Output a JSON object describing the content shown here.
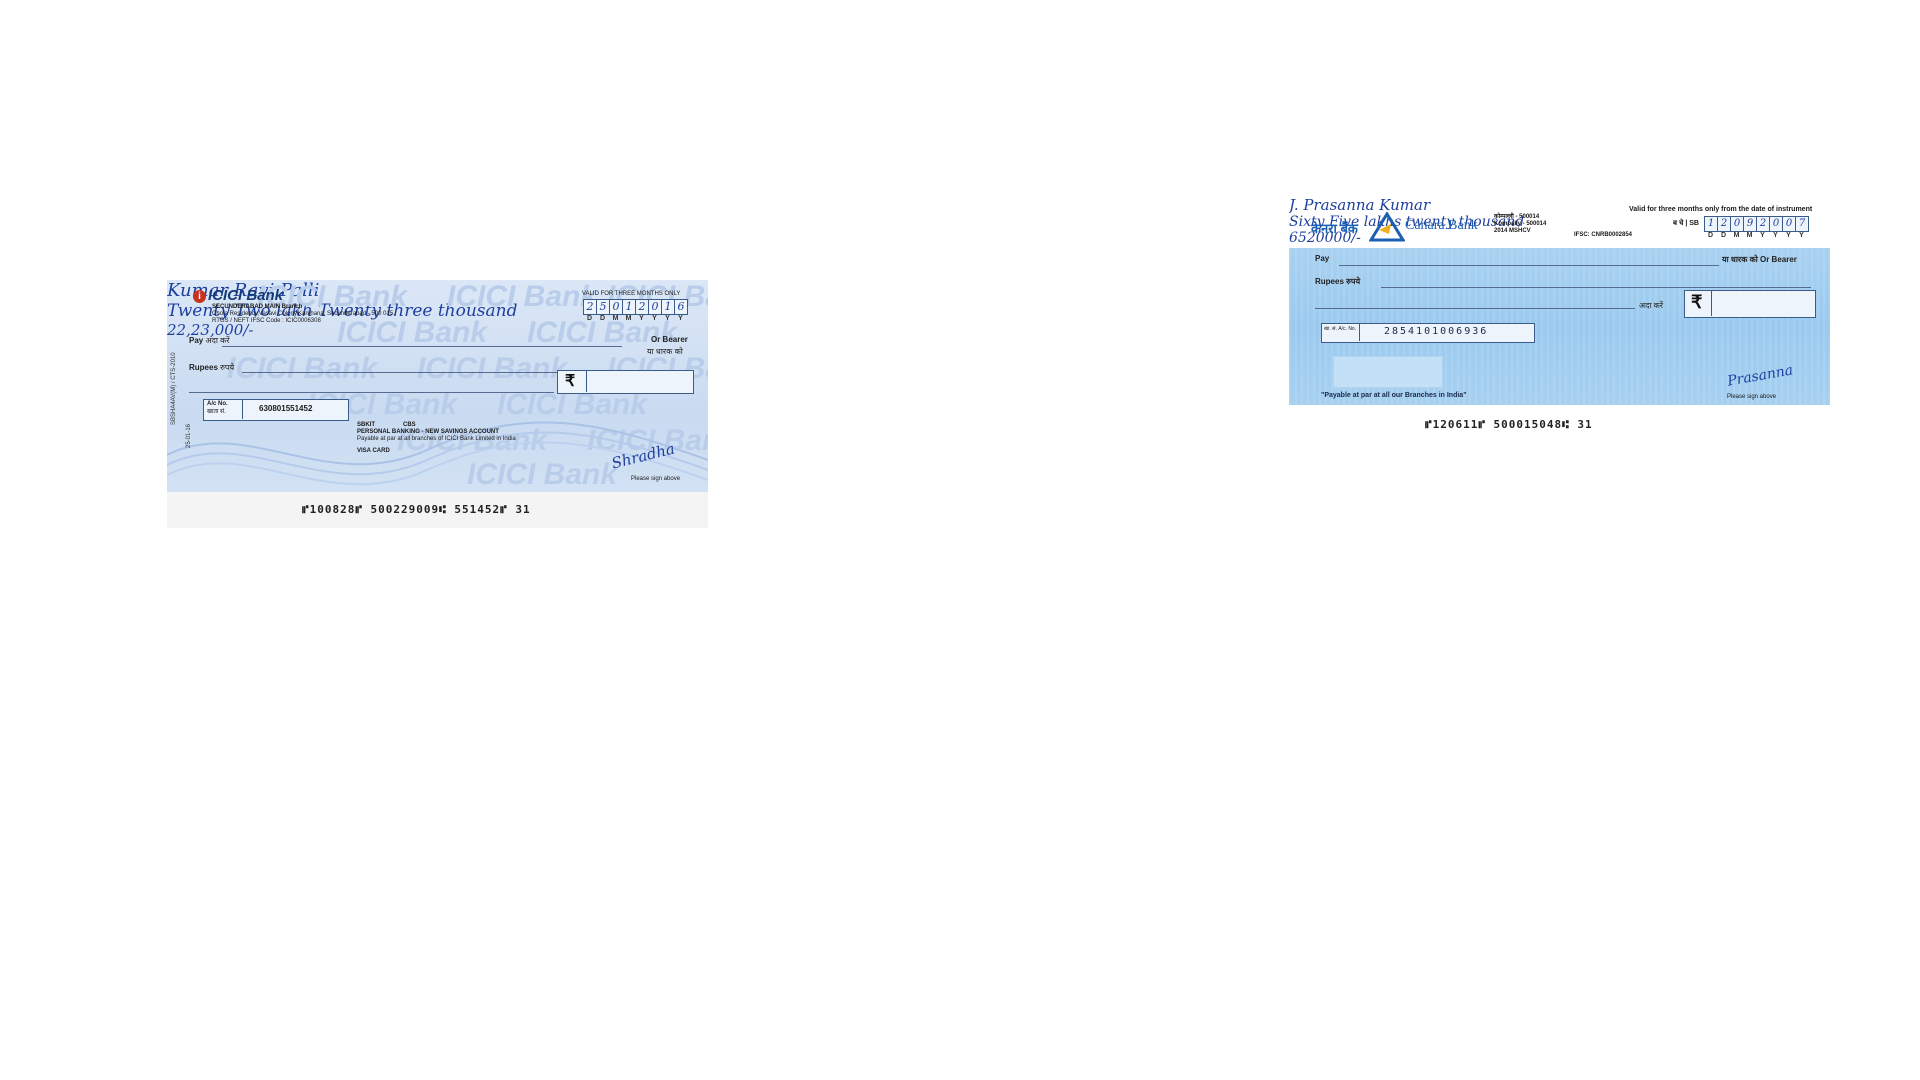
{
  "icici_cheque": {
    "bank_name": "ICICI Bank",
    "watermark": "ICICI Bank",
    "branch": "SECUNDERABAD MAIN Branch",
    "address": "Chota Residency,Vasavi Colony,Karkhana, Secunderabad - 500 015.",
    "ifsc": "RTGS / NEFT IFSC Code : ICIC0006308",
    "validity": "VALID FOR THREE MONTHS ONLY",
    "date_digits": [
      "2",
      "5",
      "0",
      "1",
      "2",
      "0",
      "1",
      "6"
    ],
    "date_format": [
      "D",
      "D",
      "M",
      "M",
      "Y",
      "Y",
      "Y",
      "Y"
    ],
    "pay_label_en": "Pay",
    "pay_label_hi": "अदा करें",
    "payee": "Kumar Ravi Palli",
    "or_bearer_en": "Or Bearer",
    "or_bearer_hi": "या धारक को",
    "rupees_label_en": "Rupees",
    "rupees_label_hi": "रुपये",
    "amount_words": "Twenty Two lakh Twenty three thousand",
    "rupee_symbol": "₹",
    "amount_figures": "22,23,000/-",
    "account_label_en": "A/c No.",
    "account_label_hi": "खाता सं.",
    "account_number": "630801551452",
    "code_1": "SBKIT",
    "code_2": "CBS",
    "account_type": "PERSONAL BANKING - NEW SAVINGS ACCOUNT",
    "payable_note": "Payable at par at all branches of ICICI Bank Limited in India",
    "card_note": "VISA CARD",
    "signature": "Shradha",
    "sign_note": "Please sign above",
    "side_text": "SBSHA4AV(M) / CTS-2010",
    "side_text_2": "25-01-16",
    "micr": "⑈100828⑈ 500229009⑆ 551452⑈ 31"
  },
  "canara_cheque": {
    "bank_name_hi": "केनरा बैंक",
    "bank_name_en": "Canara Bank",
    "address_1": "कोम्पल्ली - 500014",
    "address_2": "Kompally - 500014",
    "address_3": "2014 MSHCV",
    "ifsc": "IFSC: CNRB0002854",
    "validity": "Valid for three months only from the date of instrument",
    "sb_label": "ब चे | SB",
    "date_digits": [
      "1",
      "2",
      "0",
      "9",
      "2",
      "0",
      "0",
      "7"
    ],
    "date_format": [
      "D",
      "D",
      "M",
      "M",
      "Y",
      "Y",
      "Y",
      "Y"
    ],
    "pay_label": "Pay",
    "payee": "J. Prasanna Kumar",
    "or_bearer": "या धारक को Or Bearer",
    "rupees_label": "Rupees रुपये",
    "amount_words": "Sixty Five lakhs twenty thousand",
    "pay_hi": "अदा करें",
    "rupee_symbol": "₹",
    "amount_figures": "6520000/-",
    "account_label": "खा. सं. A/c. No.",
    "account_number": "2854101006936",
    "payable_note": "\"Payable at par at all our Branches in India\"",
    "signature": "Prasanna",
    "sign_note": "Please sign above",
    "micr": "⑈120611⑈ 500015048⑆ 31"
  },
  "colors": {
    "icici_background": "#c9dbf1",
    "canara_band": "#9bcaef",
    "ink": "#1f3f9e"
  }
}
